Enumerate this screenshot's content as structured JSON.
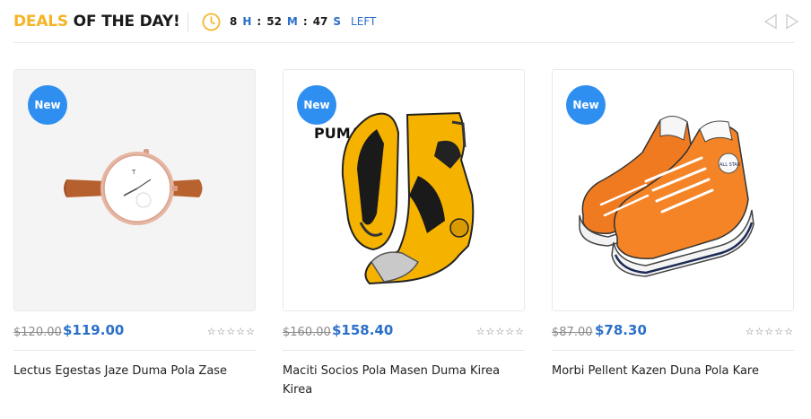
{
  "header": {
    "title_highlight": "DEALS",
    "title_rest": " OF THE DAY!",
    "countdown": {
      "hours": "8",
      "hours_unit": "H",
      "minutes": "52",
      "minutes_unit": "M",
      "seconds": "47",
      "seconds_unit": "S",
      "suffix": "LEFT"
    },
    "icons": {
      "clock": "clock-icon",
      "prev": "chevron-left-icon",
      "next": "chevron-right-icon"
    }
  },
  "colors": {
    "accent_yellow": "#f5b427",
    "accent_blue": "#2b6fc9",
    "badge_blue": "#2f8ff0"
  },
  "products": [
    {
      "badge": "New",
      "old_price": "$120.00",
      "price": "$119.00",
      "rating_stars": "☆☆☆☆☆",
      "name": "Lectus Egestas Jaze Duma Pola Zase",
      "image": "watch"
    },
    {
      "badge": "New",
      "old_price": "$160.00",
      "price": "$158.40",
      "rating_stars": "☆☆☆☆☆",
      "name": "Maciti Socios Pola Masen Duma Kirea Kirea",
      "image": "puma-boots",
      "image_text": "PUMA"
    },
    {
      "badge": "New",
      "old_price": "$87.00",
      "price": "$78.30",
      "rating_stars": "☆☆☆☆☆",
      "name": "Morbi Pellent Kazen Duna Pola Kare",
      "image": "orange-sneakers",
      "image_text": "ALL STAR"
    }
  ]
}
